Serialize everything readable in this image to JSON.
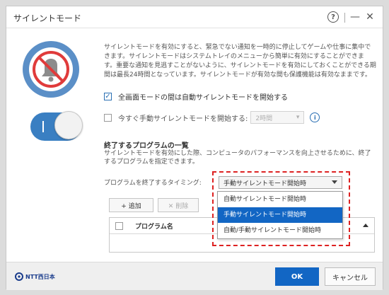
{
  "window": {
    "title": "サイレントモード",
    "help_glyph": "?",
    "minimize_glyph": "—",
    "close_glyph": "✕"
  },
  "description": "サイレントモードを有効にすると、緊急でない通知を一時的に停止してゲームや仕事に集中できます。サイレントモードはシステムトレイのメニューから簡単に有効にすることができます。重要な通知を見逃すことがないように、サイレントモードを有効にしておくことができる期間は最長24時間となっています。サイレントモードが有効な間も保護機能は有効なままです。",
  "options": {
    "fullscreen_label": "全画面モードの間は自動サイレントモードを開始する",
    "fullscreen_checked": true,
    "manual_now_label": "今すぐ手動サイレントモードを開始する:",
    "manual_now_checked": false,
    "hours_value": "2時間",
    "info_glyph": "i"
  },
  "programs": {
    "title": "終了するプログラムの一覧",
    "description": "サイレントモードを有効にした際、コンピュータのパフォーマンスを向上させるために、終了するプログラムを指定できます。",
    "timing_label": "プログラムを終了するタイミング:",
    "timing_selected": "手動サイレントモード開始時",
    "timing_options": [
      "自動サイレントモード開始時",
      "手動サイレントモード開始時",
      "自動/手動サイレントモード開始時"
    ],
    "timing_selected_index": 1,
    "add_label": "+ 追加",
    "delete_label": "✕ 削除",
    "column_header": "プログラム名"
  },
  "footer": {
    "logo_text": "NTT西日本",
    "ok_label": "OK",
    "cancel_label": "キャンセル"
  },
  "colors": {
    "accent": "#1266c4",
    "toggle": "#3a7fc2",
    "highlight_frame": "#dd2222"
  }
}
